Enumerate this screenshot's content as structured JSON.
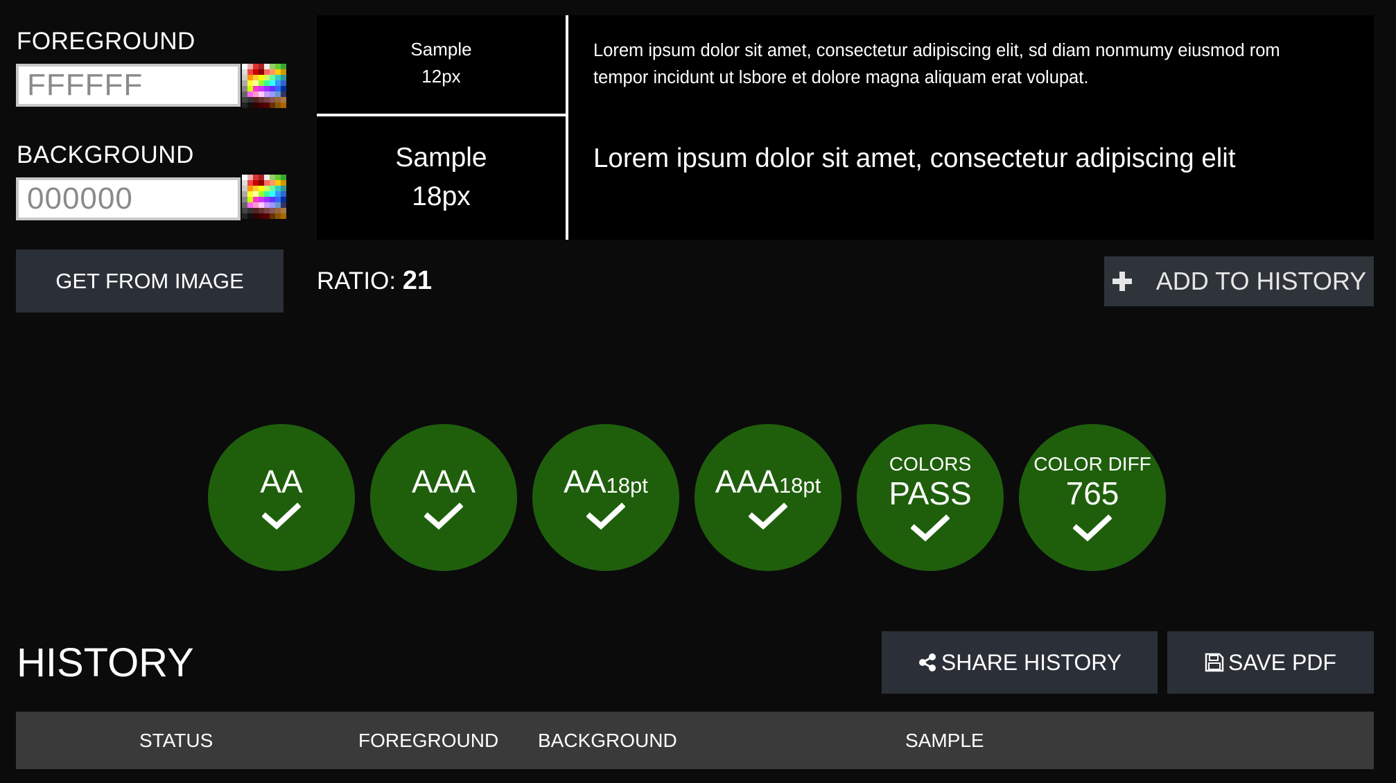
{
  "foreground": {
    "label": "FOREGROUND",
    "value": "FFFFFF",
    "picker_icon": "color-palette-icon"
  },
  "background": {
    "label": "BACKGROUND",
    "value": "000000",
    "picker_icon": "color-palette-icon"
  },
  "get_from_image_label": "GET FROM IMAGE",
  "ratio": {
    "label": "RATIO:",
    "value": "21"
  },
  "add_history": {
    "icon": "plus-icon",
    "label": "ADD TO HISTORY"
  },
  "preview": {
    "small": {
      "label_line1": "Sample",
      "label_line2": "12px",
      "text_line1": "Lorem ipsum dolor sit amet, consectetur adipiscing elit, sd diam nonmumy eiusmod rom",
      "text_line2": "tempor incidunt ut lsbore et dolore magna aliquam erat volupat."
    },
    "large": {
      "label_line1": "Sample",
      "label_line2": "18px",
      "text": "Lorem ipsum dolor sit amet, consectetur adipiscing elit"
    }
  },
  "badges": [
    {
      "top": "",
      "main": "AA",
      "sub": "",
      "icon": "checkmark-icon"
    },
    {
      "top": "",
      "main": "AAA",
      "sub": "",
      "icon": "checkmark-icon"
    },
    {
      "top": "",
      "main": "AA",
      "sub": "18pt",
      "icon": "checkmark-icon"
    },
    {
      "top": "",
      "main": "AAA",
      "sub": "18pt",
      "icon": "checkmark-icon"
    },
    {
      "top": "COLORS",
      "main": "PASS",
      "sub": "",
      "icon": "checkmark-icon"
    },
    {
      "top": "COLOR DIFF",
      "main": "765",
      "sub": "",
      "icon": "checkmark-icon"
    }
  ],
  "history": {
    "title": "HISTORY",
    "share_label": "SHARE HISTORY",
    "share_icon": "share-icon",
    "save_label": "SAVE PDF",
    "save_icon": "floppy-disk-icon",
    "columns": [
      "STATUS",
      "FOREGROUND",
      "BACKGROUND",
      "SAMPLE"
    ]
  },
  "colors": {
    "page_bg": "#0b0b0b",
    "button_bg": "#2b3038",
    "badge_green": "#1f5f0c",
    "table_header_bg": "#3a3a3a"
  }
}
